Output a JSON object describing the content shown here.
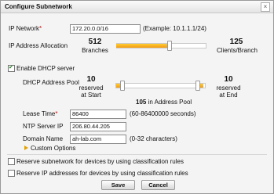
{
  "dialog": {
    "title": "Configure Subnetwork",
    "close_glyph": "×"
  },
  "ip_network": {
    "label": "IP Network",
    "required_mark": "*",
    "value": "172.20.0.0/16",
    "example": "(Example: 10.1.1.1/24)"
  },
  "allocation": {
    "label": "IP Address Allocation",
    "branches_value": "512",
    "branches_label": "Branches",
    "clients_value": "125",
    "clients_label": "Clients/Branch",
    "slider_position_fraction": 0.28
  },
  "dhcp": {
    "enable_label": "Enable DHCP server",
    "enabled": true
  },
  "pool": {
    "label": "DHCP Address Pool",
    "start_value": "10",
    "start_label_1": "reserved",
    "start_label_2": "at Start",
    "end_value": "10",
    "end_label_1": "reserved",
    "end_label_2": "at End",
    "address_count": "105",
    "address_count_label": "in Address Pool"
  },
  "lease": {
    "label": "Lease Time",
    "required_mark": "*",
    "value": "86400",
    "hint": "(60-86400000 seconds)"
  },
  "ntp": {
    "label": "NTP Server IP",
    "value": "206.80.44.205"
  },
  "domain": {
    "label": "Domain Name",
    "value": "ah-lab.com",
    "hint": "(0-32 characters)"
  },
  "custom_options": {
    "label": "Custom Options"
  },
  "reserve": {
    "subnetwork_label": "Reserve subnetwork for devices by using classification rules",
    "ip_label": "Reserve IP addresses for devices by using classification rules"
  },
  "buttons": {
    "save": "Save",
    "cancel": "Cancel"
  },
  "colors": {
    "accent": "#f39c12",
    "required": "#dd0000"
  }
}
